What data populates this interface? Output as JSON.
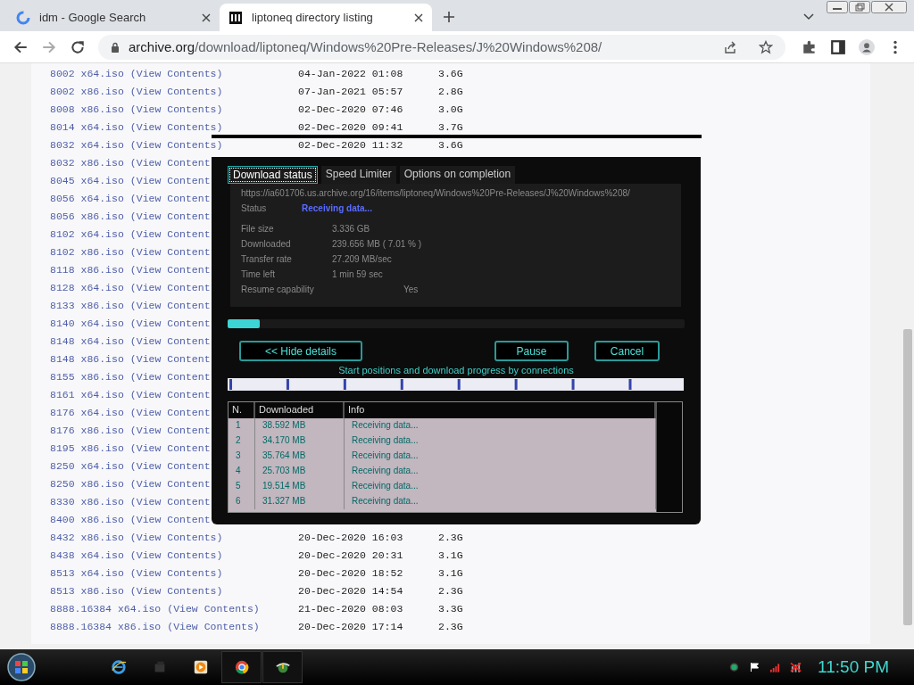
{
  "browser": {
    "tabs": [
      {
        "title": "idm - Google Search",
        "selected": false
      },
      {
        "title": "liptoneq directory listing",
        "selected": true
      }
    ],
    "address": {
      "host": "archive.org",
      "path": "/download/liptoneq/Windows%20Pre-Releases/J%20Windows%208/"
    }
  },
  "listing": {
    "rows": [
      {
        "name": "8002 x64.iso",
        "link": "(View Contents)",
        "date": "04-Jan-2022 01:08",
        "size": "3.6G"
      },
      {
        "name": "8002 x86.iso",
        "link": "(View Contents)",
        "date": "07-Jan-2021 05:57",
        "size": "2.8G"
      },
      {
        "name": "8008 x86.iso",
        "link": "(View Contents)",
        "date": "02-Dec-2020 07:46",
        "size": "3.0G"
      },
      {
        "name": "8014 x64.iso",
        "link": "(View Contents)",
        "date": "02-Dec-2020 09:41",
        "size": "3.7G"
      },
      {
        "name": "8032 x64.iso",
        "link": "(View Contents)",
        "date": "02-Dec-2020 11:32",
        "size": "3.6G"
      },
      {
        "name": "8032 x86.iso",
        "link": "(View Content"
      },
      {
        "name": "8045 x64.iso",
        "link": "(View Content"
      },
      {
        "name": "8056 x64.iso",
        "link": "(View Content"
      },
      {
        "name": "8056 x86.iso",
        "link": "(View Content"
      },
      {
        "name": "8102 x64.iso",
        "link": "(View Content"
      },
      {
        "name": "8102 x86.iso",
        "link": "(View Content"
      },
      {
        "name": "8118 x86.iso",
        "link": "(View Content"
      },
      {
        "name": "8128 x64.iso",
        "link": "(View Content"
      },
      {
        "name": "8133 x86.iso",
        "link": "(View Content"
      },
      {
        "name": "8140 x64.iso",
        "link": "(View Content"
      },
      {
        "name": "8148 x64.iso",
        "link": "(View Content"
      },
      {
        "name": "8148 x86.iso",
        "link": "(View Content"
      },
      {
        "name": "8155 x86.iso",
        "link": "(View Content"
      },
      {
        "name": "8161 x64.iso",
        "link": "(View Content"
      },
      {
        "name": "8176 x64.iso",
        "link": "(View Content"
      },
      {
        "name": "8176 x86.iso",
        "link": "(View Content"
      },
      {
        "name": "8195 x86.iso",
        "link": "(View Content"
      },
      {
        "name": "8250 x64.iso",
        "link": "(View Content"
      },
      {
        "name": "8250 x86.iso",
        "link": "(View Content"
      },
      {
        "name": "8330 x86.iso",
        "link": "(View Content"
      },
      {
        "name": "8400 x86.iso",
        "link": "(View Content"
      },
      {
        "name": "8432 x86.iso",
        "link": "(View Contents)",
        "date": "20-Dec-2020 16:03",
        "size": "2.3G"
      },
      {
        "name": "8438 x64.iso",
        "link": "(View Contents)",
        "date": "20-Dec-2020 20:31",
        "size": "3.1G"
      },
      {
        "name": "8513 x64.iso",
        "link": "(View Contents)",
        "date": "20-Dec-2020 18:52",
        "size": "3.1G"
      },
      {
        "name": "8513 x86.iso",
        "link": "(View Contents)",
        "date": "20-Dec-2020 14:54",
        "size": "2.3G"
      },
      {
        "name": "8888.16384 x64.iso",
        "link": "(View Contents)",
        "date": "21-Dec-2020 08:03",
        "size": "3.3G"
      },
      {
        "name": "8888.16384 x86.iso",
        "link": "(View Contents)",
        "date": "20-Dec-2020 17:14",
        "size": "2.3G"
      }
    ]
  },
  "dialog": {
    "tabs": [
      {
        "label": "Download status",
        "selected": true
      },
      {
        "label": "Speed Limiter",
        "selected": false
      },
      {
        "label": "Options on completion",
        "selected": false
      }
    ],
    "url": "https://ia601706.us.archive.org/16/items/liptoneq/Windows%20Pre-Releases/J%20Windows%208/",
    "status": {
      "label": "Status",
      "value": "Receiving data..."
    },
    "details": [
      {
        "label": "File size",
        "value": "3.336  GB"
      },
      {
        "label": "Downloaded",
        "value": "239.656  MB  ( 7.01 % )"
      },
      {
        "label": "Transfer rate",
        "value": "27.209  MB/sec"
      },
      {
        "label": "Time left",
        "value": "1 min 59 sec"
      },
      {
        "label": "Resume capability",
        "value": "Yes"
      }
    ],
    "progress": {
      "level": 0.0701
    },
    "buttons": {
      "hide": "<< Hide details",
      "pause": "Pause",
      "cancel": "Cancel"
    },
    "connections_caption": "Start positions and download progress by connections",
    "table": {
      "columns": [
        "N.",
        "Downloaded",
        "Info"
      ],
      "rows": [
        {
          "n": "1",
          "downloaded": "38.592  MB",
          "info": "Receiving data..."
        },
        {
          "n": "2",
          "downloaded": "34.170  MB",
          "info": "Receiving data..."
        },
        {
          "n": "3",
          "downloaded": "35.764  MB",
          "info": "Receiving data..."
        },
        {
          "n": "4",
          "downloaded": "25.703  MB",
          "info": "Receiving data..."
        },
        {
          "n": "5",
          "downloaded": "19.514  MB",
          "info": "Receiving data..."
        },
        {
          "n": "6",
          "downloaded": "31.327  MB",
          "info": "Receiving data..."
        }
      ]
    }
  },
  "taskbar": {
    "clock": "11:50 PM"
  }
}
